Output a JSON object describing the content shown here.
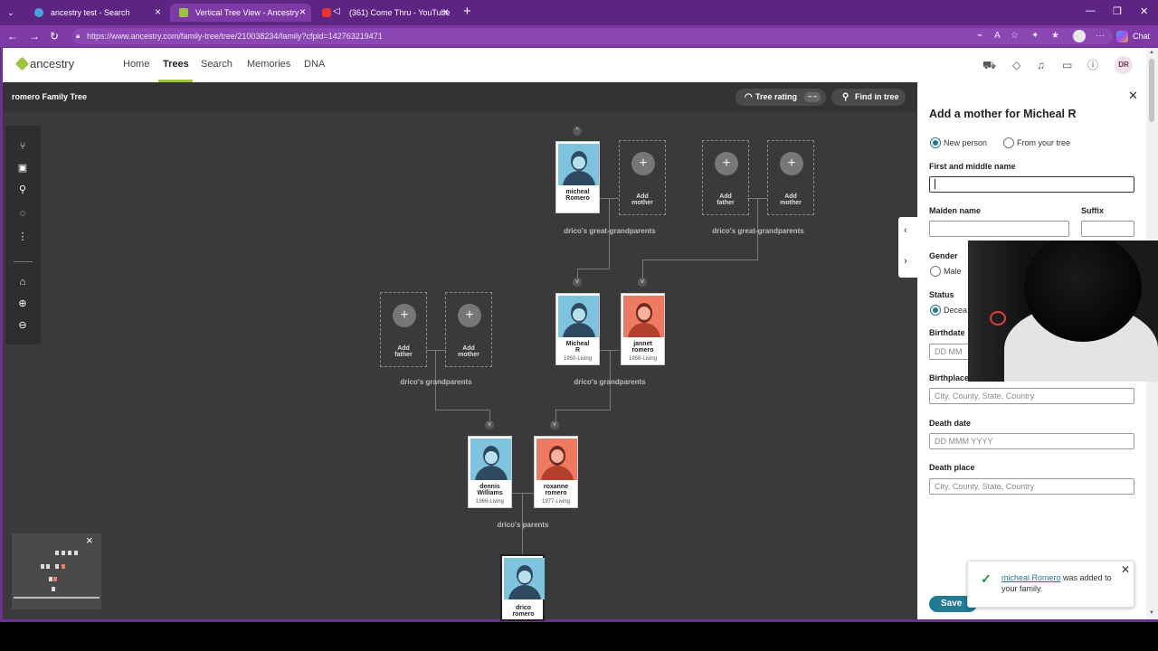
{
  "browser": {
    "tabs": [
      {
        "title": "ancestry test - Search"
      },
      {
        "title": "Vertical Tree View - Ancestry"
      },
      {
        "title": "(361) Come Thru - YouTube"
      }
    ],
    "url": "https://www.ancestry.com/family-tree/tree/210038234/family?cfpid=142763219471",
    "chat_label": "Chat"
  },
  "header": {
    "logo": "ancestry",
    "nav": [
      "Home",
      "Trees",
      "Search",
      "Memories",
      "DNA"
    ],
    "avatar": "DR"
  },
  "toolbar": {
    "tree_title": "romero Family Tree",
    "rating_label": "Tree rating",
    "rating_value": "– –",
    "find_label": "Find in tree"
  },
  "tree": {
    "people": [
      {
        "name1": "micheal",
        "name2": "Romero",
        "name3": "",
        "dates": "",
        "sex": "male"
      },
      {
        "name1": "Micheal",
        "name2": "R",
        "name3": "",
        "dates": "1950-Living",
        "sex": "male"
      },
      {
        "name1": "jannet",
        "name2": "romero",
        "name3": "",
        "dates": "1956-Living",
        "sex": "female"
      },
      {
        "name1": "dennis",
        "name2": "Williams",
        "name3": "",
        "dates": "1966-Living",
        "sex": "male"
      },
      {
        "name1": "roxanne",
        "name2": "romero",
        "name3": "",
        "dates": "1977-Living",
        "sex": "female"
      },
      {
        "name1": "drico",
        "name2": "romero",
        "name3": "",
        "dates": "",
        "sex": "male"
      }
    ],
    "add_father": [
      "Add",
      "father"
    ],
    "add_mother": [
      "Add",
      "mother"
    ],
    "labels": {
      "great_gp_1": "drico's great-grandparents",
      "great_gp_2": "drico's great-grandparents",
      "gp_1": "drico's grandparents",
      "gp_2": "drico's grandparents",
      "parents": "drico's parents"
    }
  },
  "panel": {
    "title": "Add a mother for Micheal R",
    "opt_new": "New person",
    "opt_tree": "From your tree",
    "first_middle_label": "First and middle name",
    "first_middle_value": "",
    "maiden_label": "Maiden name",
    "suffix_label": "Suffix",
    "gender_label": "Gender",
    "gender_male": "Male",
    "status_label": "Status",
    "status_value": "Decea",
    "birthdate_label": "Birthdate",
    "birthdate_placeholder": "DD MM",
    "birthplace_label": "Birthplace",
    "birthplace_placeholder": "City, County, State, Country",
    "deathdate_label": "Death date",
    "deathdate_placeholder": "DD MMM YYYY",
    "deathplace_label": "Death place",
    "deathplace_placeholder": "City, County, State, Country",
    "save": "Save"
  },
  "toast": {
    "link": "micheal Romero",
    "message": " was added to your family."
  }
}
